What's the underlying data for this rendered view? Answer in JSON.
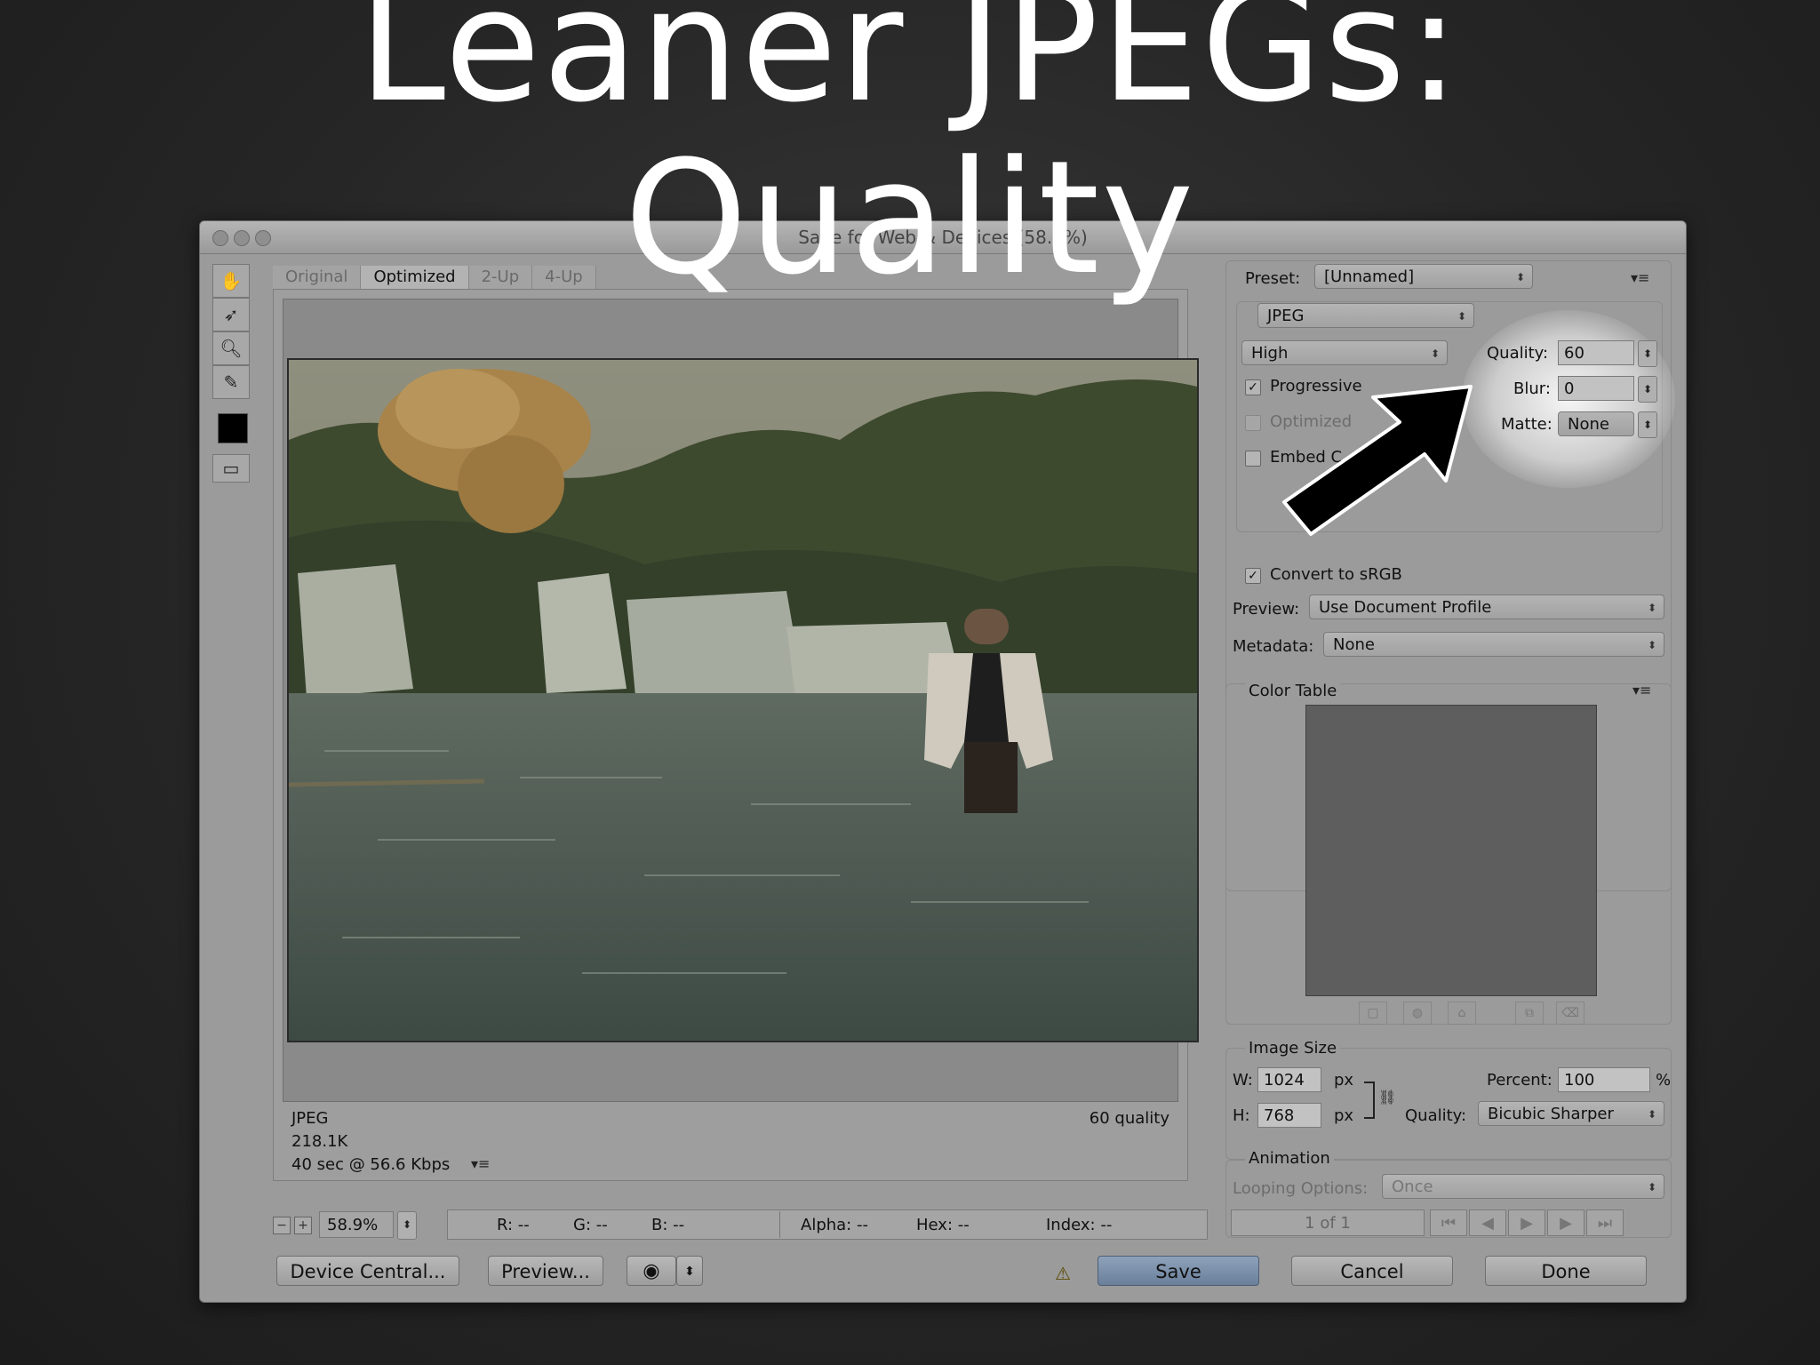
{
  "slide": {
    "title_line1": "Leaner JPEGs:",
    "title_line2": "Quality"
  },
  "window": {
    "title": "Save for Web & Devices (58.9%)"
  },
  "tabs": [
    "Original",
    "Optimized",
    "2-Up",
    "4-Up"
  ],
  "preview_info": {
    "format": "JPEG",
    "size": "218.1K",
    "time": "40 sec @ 56.6 Kbps",
    "quality": "60 quality"
  },
  "statusbar": {
    "zoom": "58.9%",
    "r": "R: --",
    "g": "G: --",
    "b": "B: --",
    "alpha": "Alpha: --",
    "hex": "Hex: --",
    "index": "Index: --"
  },
  "buttons": {
    "device_central": "Device Central...",
    "preview": "Preview...",
    "save": "Save",
    "cancel": "Cancel",
    "done": "Done"
  },
  "settings": {
    "preset_label": "Preset:",
    "preset_value": "[Unnamed]",
    "format_value": "JPEG",
    "compression_value": "High",
    "quality_label": "Quality:",
    "quality_value": "60",
    "blur_label": "Blur:",
    "blur_value": "0",
    "matte_label": "Matte:",
    "matte_value": "None",
    "progressive_label": "Progressive",
    "optimized_label": "Optimized",
    "embed_label": "Embed C",
    "convert_label": "Convert to sRGB",
    "preview_label": "Preview:",
    "preview_value": "Use Document Profile",
    "metadata_label": "Metadata:",
    "metadata_value": "None"
  },
  "color_table": {
    "label": "Color Table"
  },
  "image_size": {
    "label": "Image Size",
    "w_label": "W:",
    "w_value": "1024",
    "w_unit": "px",
    "h_label": "H:",
    "h_value": "768",
    "h_unit": "px",
    "percent_label": "Percent:",
    "percent_value": "100",
    "percent_unit": "%",
    "quality_label": "Quality:",
    "quality_value": "Bicubic Sharper"
  },
  "animation": {
    "label": "Animation",
    "looping_label": "Looping Options:",
    "looping_value": "Once",
    "frame": "1 of 1"
  },
  "colors": {
    "window": "#9b9b9b",
    "save_button": "#7a8ea9",
    "arrow": "#000000"
  }
}
